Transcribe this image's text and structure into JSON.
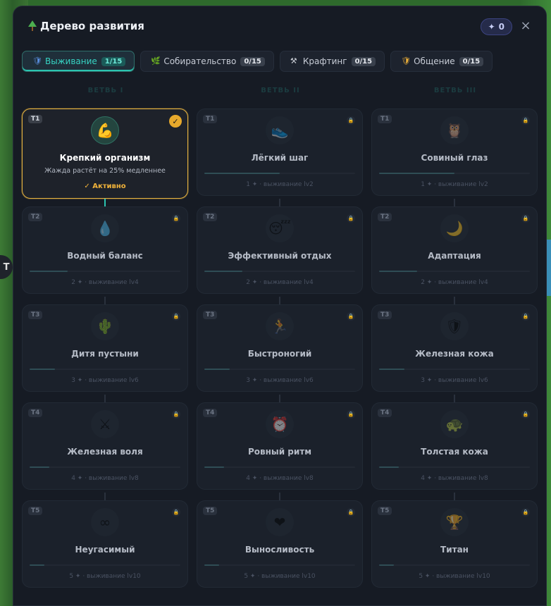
{
  "window": {
    "title": "Дерево развития",
    "points": "0",
    "close": "×"
  },
  "tabs": [
    {
      "label": "Выживание",
      "count": "1/15",
      "icon": "shield-icon",
      "active": true
    },
    {
      "label": "Собирательство",
      "count": "0/15",
      "icon": "leaf-icon",
      "active": false
    },
    {
      "label": "Крафтинг",
      "count": "0/15",
      "icon": "hammer-icon",
      "active": false
    },
    {
      "label": "Общение",
      "count": "0/15",
      "icon": "badge-icon",
      "active": false
    }
  ],
  "branches": [
    {
      "label": "ВЕТВЬ I",
      "nodes": [
        {
          "tier": "T1",
          "name": "Крепкий организм",
          "desc": "Жажда растёт на 25% медленнее",
          "status": "✓ Активно",
          "icon": "💪",
          "active": true
        },
        {
          "tier": "T2",
          "name": "Водный баланс",
          "req": "2 ✦ · выживание lv4",
          "icon": "💧",
          "progress": 0.25
        },
        {
          "tier": "T3",
          "name": "Дитя пустыни",
          "req": "3 ✦ · выживание lv6",
          "icon": "🌵",
          "progress": 0.17
        },
        {
          "tier": "T4",
          "name": "Железная воля",
          "req": "4 ✦ · выживание lv8",
          "icon": "⚔",
          "progress": 0.13
        },
        {
          "tier": "T5",
          "name": "Неугасимый",
          "req": "5 ✦ · выживание lv10",
          "icon": "∞",
          "progress": 0.1
        }
      ]
    },
    {
      "label": "ВЕТВЬ II",
      "nodes": [
        {
          "tier": "T1",
          "name": "Лёгкий шаг",
          "req": "1 ✦ · выживание lv2",
          "icon": "👟",
          "progress": 0.5
        },
        {
          "tier": "T2",
          "name": "Эффективный отдых",
          "req": "2 ✦ · выживание lv4",
          "icon": "😴",
          "progress": 0.25
        },
        {
          "tier": "T3",
          "name": "Быстроногий",
          "req": "3 ✦ · выживание lv6",
          "icon": "🏃",
          "progress": 0.17
        },
        {
          "tier": "T4",
          "name": "Ровный ритм",
          "req": "4 ✦ · выживание lv8",
          "icon": "⏰",
          "progress": 0.13
        },
        {
          "tier": "T5",
          "name": "Выносливость",
          "req": "5 ✦ · выживание lv10",
          "icon": "❤",
          "progress": 0.1
        }
      ]
    },
    {
      "label": "ВЕТВЬ III",
      "nodes": [
        {
          "tier": "T1",
          "name": "Совиный глаз",
          "req": "1 ✦ · выживание lv2",
          "icon": "🦉",
          "progress": 0.5
        },
        {
          "tier": "T2",
          "name": "Адаптация",
          "req": "2 ✦ · выживание lv4",
          "icon": "🌙",
          "progress": 0.25
        },
        {
          "tier": "T3",
          "name": "Железная кожа",
          "req": "3 ✦ · выживание lv6",
          "icon": "🛡",
          "progress": 0.17
        },
        {
          "tier": "T4",
          "name": "Толстая кожа",
          "req": "4 ✦ · выживание lv8",
          "icon": "🐢",
          "progress": 0.13
        },
        {
          "tier": "T5",
          "name": "Титан",
          "req": "5 ✦ · выживание lv10",
          "icon": "🏆",
          "progress": 0.1
        }
      ]
    }
  ],
  "colors": {
    "accent": "#2bc4b0",
    "active_border": "#e3b140",
    "background": "#161b24"
  }
}
